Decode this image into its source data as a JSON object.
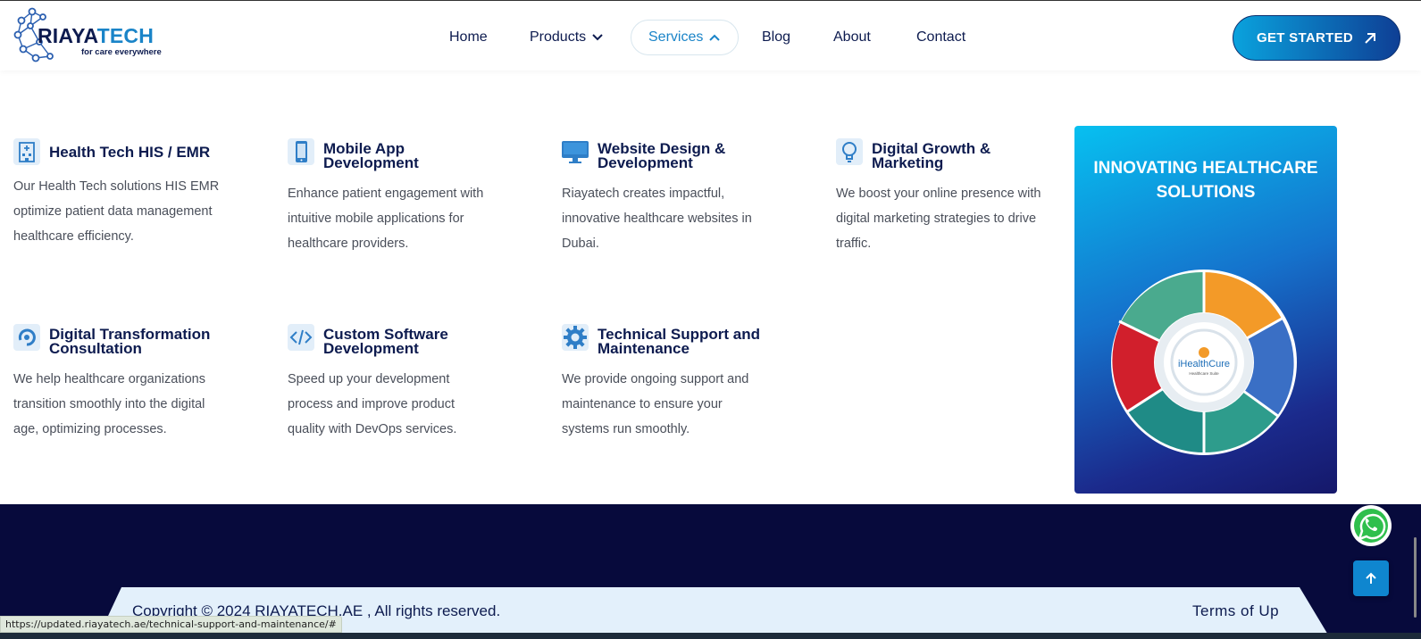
{
  "brand": {
    "name_part1": "RIAYA",
    "name_part2": "TECH",
    "tagline": "for care everywhere"
  },
  "nav": {
    "items": [
      {
        "label": "Home"
      },
      {
        "label": "Products",
        "chevron": "chevron-down-icon"
      },
      {
        "label": "Services",
        "chevron": "chevron-up-icon",
        "active": true
      },
      {
        "label": "Blog"
      },
      {
        "label": "About"
      },
      {
        "label": "Contact"
      }
    ],
    "cta_label": "GET STARTED",
    "cta_icon": "arrow-up-right-icon"
  },
  "services": [
    {
      "icon": "hospital-building-icon",
      "title": "Health Tech HIS / EMR",
      "desc": "Our Health Tech solutions HIS EMR optimize patient data management healthcare efficiency."
    },
    {
      "icon": "smartphone-icon",
      "title": "Mobile App Development",
      "desc": "Enhance patient engagement with intuitive mobile applications for healthcare providers."
    },
    {
      "icon": "monitor-icon",
      "title": "Website Design & Development",
      "desc": "Riayatech creates impactful, innovative healthcare websites in Dubai."
    },
    {
      "icon": "lightbulb-icon",
      "title": "Digital Growth & Marketing",
      "desc": "We boost your online presence with digital marketing strategies to drive traffic."
    },
    {
      "icon": "refresh-cycle-icon",
      "title": "Digital Transformation Consultation",
      "desc": "We help healthcare organizations transition smoothly into the digital age, optimizing processes."
    },
    {
      "icon": "code-icon",
      "title": "Custom Software Development",
      "desc": "Speed up your development process and improve product quality with DevOps services."
    },
    {
      "icon": "gear-icon",
      "title": "Technical Support and Maintenance",
      "desc": "We provide ongoing support and maintenance to ensure your systems run smoothly."
    }
  ],
  "promo": {
    "title": "INNOVATING HEALTHCARE SOLUTIONS",
    "wheel_center_label": "iHealthCure",
    "wheel_center_sub": "Healthcare Suite"
  },
  "footer": {
    "copyright": "Copyright © 2024 RIAYATECH.AE , All rights reserved.",
    "terms": "Terms of Up"
  },
  "status_bar_url": "https://updated.riayatech.ae/technical-support-and-maintenance/#",
  "colors": {
    "navy": "#0d1b4f",
    "accent": "#1a84c8",
    "footer_bg": "#070a3c"
  }
}
